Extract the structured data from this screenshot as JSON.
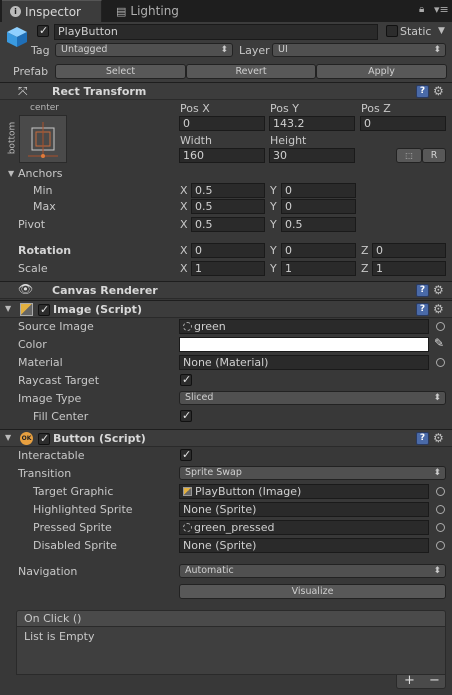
{
  "tabs": [
    {
      "label": "Inspector",
      "active": true
    },
    {
      "label": "Lighting",
      "active": false
    }
  ],
  "object": {
    "name": "PlayButton",
    "static_label": "Static",
    "tag_label": "Tag",
    "tag_value": "Untagged",
    "layer_label": "Layer",
    "layer_value": "UI",
    "prefab_label": "Prefab",
    "prefab_buttons": [
      "Select",
      "Revert",
      "Apply"
    ]
  },
  "rect_transform": {
    "title": "Rect Transform",
    "anchor_h": "center",
    "anchor_v": "bottom",
    "col_labels": [
      "Pos X",
      "Pos Y",
      "Pos Z"
    ],
    "pos": [
      "0",
      "143.2",
      "0"
    ],
    "size_labels": [
      "Width",
      "Height"
    ],
    "size": [
      "160",
      "30"
    ],
    "raw_btn": "R",
    "anchors_label": "Anchors",
    "min_label": "Min",
    "max_label": "Max",
    "min": [
      "0.5",
      "0"
    ],
    "max": [
      "0.5",
      "0"
    ],
    "pivot_label": "Pivot",
    "pivot": [
      "0.5",
      "0.5"
    ],
    "rotation_label": "Rotation",
    "rotation": [
      "0",
      "0",
      "0"
    ],
    "scale_label": "Scale",
    "scale": [
      "1",
      "1",
      "1"
    ],
    "axis": [
      "X",
      "Y",
      "Z"
    ]
  },
  "canvas_renderer": {
    "title": "Canvas Renderer"
  },
  "image_script": {
    "title": "Image (Script)",
    "source_label": "Source Image",
    "source_value": "green",
    "color_label": "Color",
    "color_value": "#ffffff",
    "material_label": "Material",
    "material_value": "None (Material)",
    "raycast_label": "Raycast Target",
    "image_type_label": "Image Type",
    "image_type_value": "Sliced",
    "fill_center_label": "Fill Center"
  },
  "button_script": {
    "title": "Button (Script)",
    "interactable_label": "Interactable",
    "transition_label": "Transition",
    "transition_value": "Sprite Swap",
    "target_graphic_label": "Target Graphic",
    "target_graphic_value": "PlayButton (Image)",
    "highlighted_label": "Highlighted Sprite",
    "highlighted_value": "None (Sprite)",
    "pressed_label": "Pressed Sprite",
    "pressed_value": "green_pressed",
    "disabled_label": "Disabled Sprite",
    "disabled_value": "None (Sprite)",
    "navigation_label": "Navigation",
    "navigation_value": "Automatic",
    "visualize_label": "Visualize",
    "onclick_title": "On Click ()",
    "onclick_empty": "List is Empty",
    "add_label": "+",
    "remove_label": "−"
  }
}
